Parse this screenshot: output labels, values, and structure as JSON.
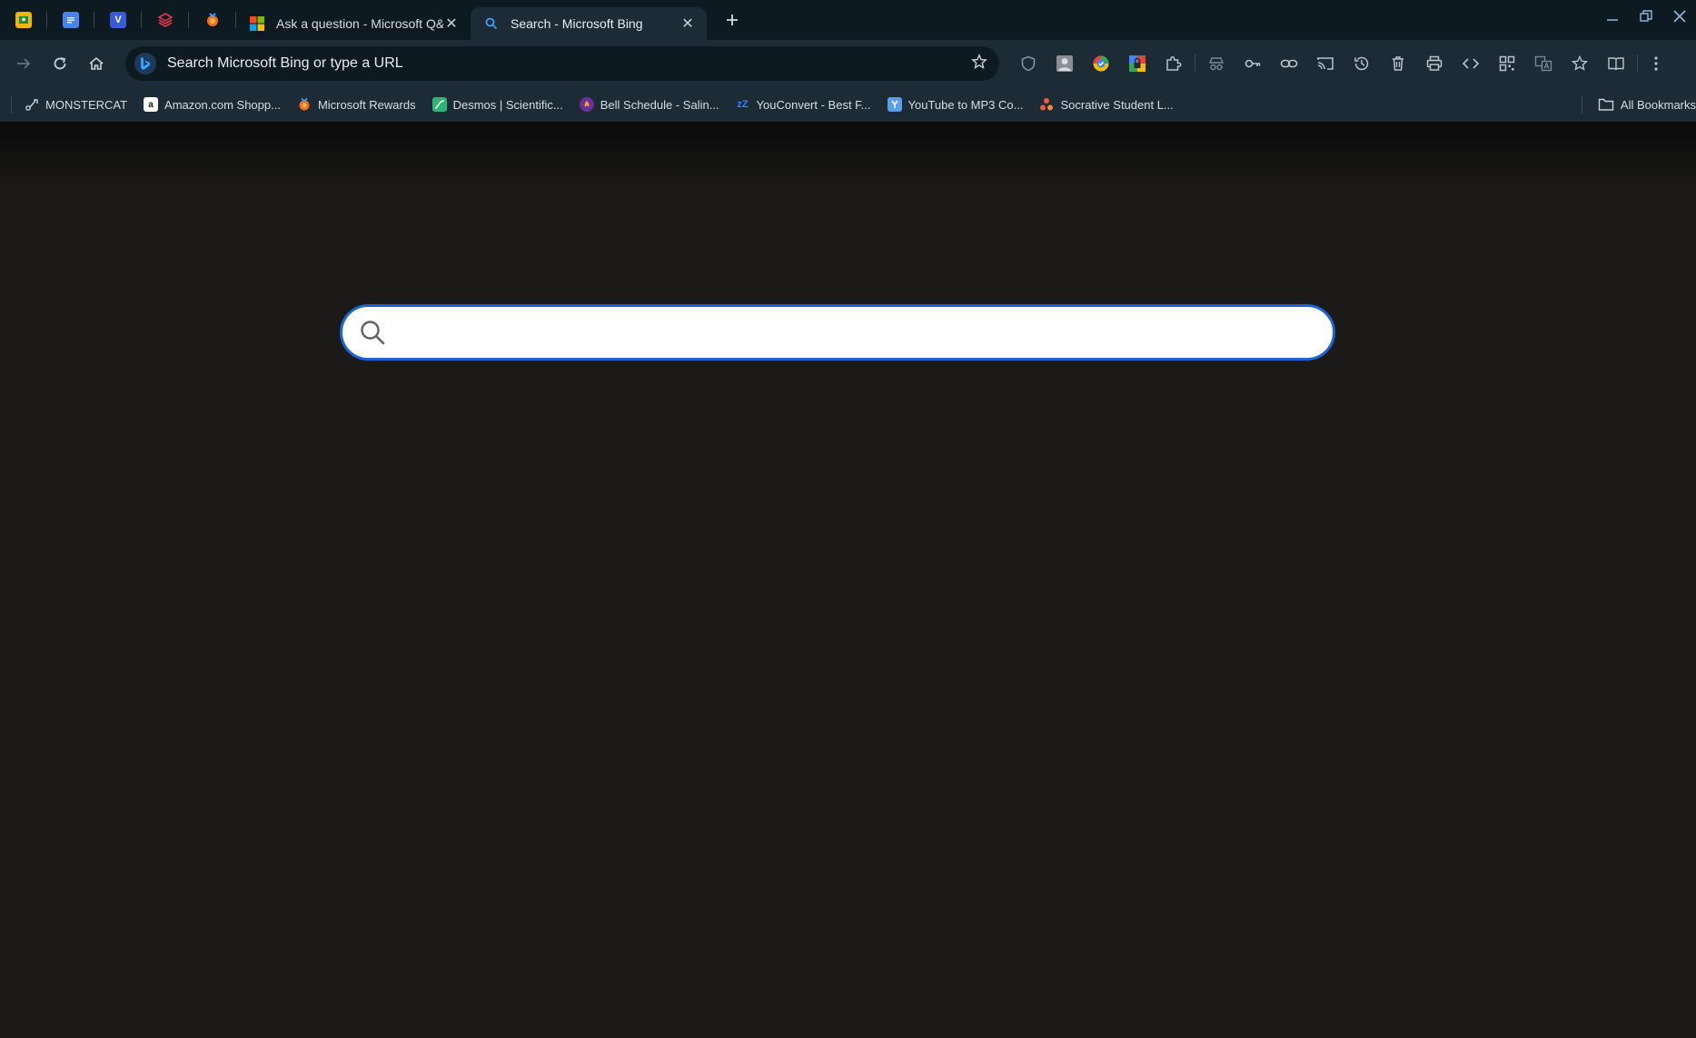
{
  "tabs": {
    "pinned": [
      {
        "icon": "classroom-icon",
        "color": "#f4b400"
      },
      {
        "icon": "docs-icon",
        "color": "#4285f4"
      },
      {
        "icon": "vocab-icon",
        "color": "#3a5bd9"
      },
      {
        "icon": "layers-icon",
        "color": "#e2364b"
      },
      {
        "icon": "rewards-icon",
        "color": "#f36b21"
      }
    ],
    "items": [
      {
        "title": "Ask a question - Microsoft Q&A",
        "icon": "microsoft-logo-icon",
        "active": false
      },
      {
        "title": "Search - Microsoft Bing",
        "icon": "search-icon",
        "active": true
      }
    ]
  },
  "toolbar": {
    "omnibox_placeholder": "Search Microsoft Bing or type a URL"
  },
  "bookmarks": [
    {
      "label": "MONSTERCAT",
      "icon": "monstercat-icon",
      "color": "#9aa5ad"
    },
    {
      "label": "Amazon.com Shopp...",
      "icon": "amazon-icon",
      "color": "#ffffff"
    },
    {
      "label": "Microsoft Rewards",
      "icon": "rewards-icon",
      "color": "#f36b21"
    },
    {
      "label": "Desmos | Scientific...",
      "icon": "desmos-icon",
      "color": "#2bb673"
    },
    {
      "label": "Bell Schedule - Salin...",
      "icon": "bell-schedule-icon",
      "color": "#6b2fa0"
    },
    {
      "label": "YouConvert - Best F...",
      "icon": "youconvert-icon",
      "color": "#3b82f6"
    },
    {
      "label": "YouTube to MP3 Co...",
      "icon": "yt-mp3-icon",
      "color": "#5aa0e8"
    },
    {
      "label": "Socrative Student L...",
      "icon": "socrative-icon",
      "color": "#f05a3a"
    }
  ],
  "all_bookmarks_label": "All Bookmarks",
  "search": {
    "placeholder": ""
  }
}
